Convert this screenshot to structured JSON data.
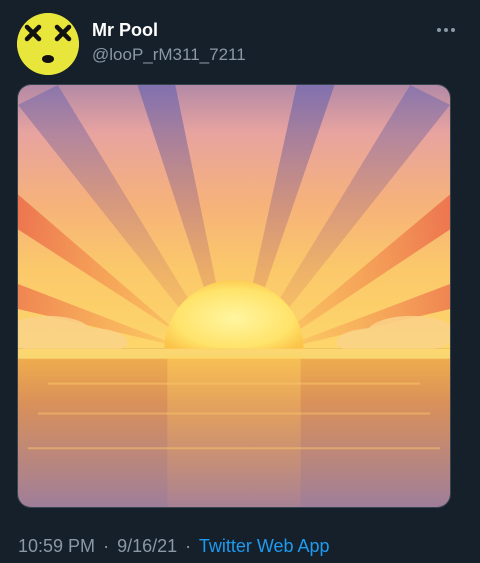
{
  "author": {
    "display_name": "Mr Pool",
    "handle": "@looP_rM311_7211",
    "avatar_icon": "dizzy-face-emoji"
  },
  "menu_icon": "more-options-icon",
  "media": {
    "icon": "sunrise-over-water-emoji"
  },
  "meta": {
    "time": "10:59 PM",
    "separator": "·",
    "date": "9/16/21",
    "source": "Twitter Web App"
  },
  "colors": {
    "background": "#15202b",
    "primary_text": "#ffffff",
    "secondary_text": "#8b98a5",
    "link": "#1d9bf0"
  }
}
